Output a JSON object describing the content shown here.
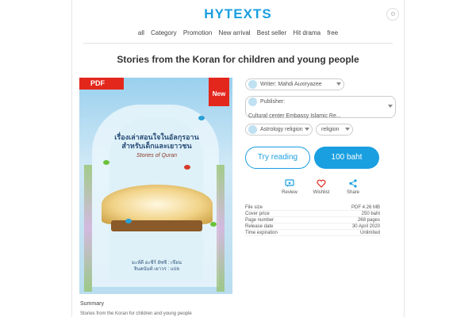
{
  "site": {
    "logo": "HYTEXTS"
  },
  "nav": [
    "all",
    "Category",
    "Promotion",
    "New arrival",
    "Best seller",
    "Hit drama",
    "free"
  ],
  "book": {
    "title": "Stories from the Koran for children and young people",
    "badge_pdf": "PDF",
    "badge_new": "New",
    "cover_title_line1": "เรื่องเล่าสอนใจในอัลกุรอาน",
    "cover_title_line2": "สำหรับเด็กและเยาวชน",
    "cover_subtitle": "Stories of Quran",
    "cover_author": "มะห์ดี อะซีร์ ยัซซี : เขียน\nจินตนันท์ เยาวร : แปล"
  },
  "writer_label": "Writer: Mahdi Auxiryazee",
  "publisher_label": "Publisher:",
  "publisher_value": "Cultural center Embassy Islamic Re...",
  "tags": [
    "Astrology religion",
    "religion"
  ],
  "buttons": {
    "try": "Try reading",
    "price": "100 baht"
  },
  "actions": [
    {
      "label": "Review",
      "icon": "review-icon"
    },
    {
      "label": "Wishlist",
      "icon": "heart-icon"
    },
    {
      "label": "Share",
      "icon": "share-icon"
    }
  ],
  "meta": [
    {
      "k": "File size",
      "v": "PDF 4.26 MB"
    },
    {
      "k": "Cover price",
      "v": "250 baht"
    },
    {
      "k": "Page number",
      "v": "268 pages"
    },
    {
      "k": "Release date",
      "v": "30 April 2020"
    },
    {
      "k": "Time expiration",
      "v": "Unlimited"
    }
  ],
  "summary": {
    "heading": "Summary",
    "text": "Stories from the Koran for children and young people"
  },
  "colors": {
    "accent": "#1a9fe0",
    "badge": "#e3271d"
  }
}
